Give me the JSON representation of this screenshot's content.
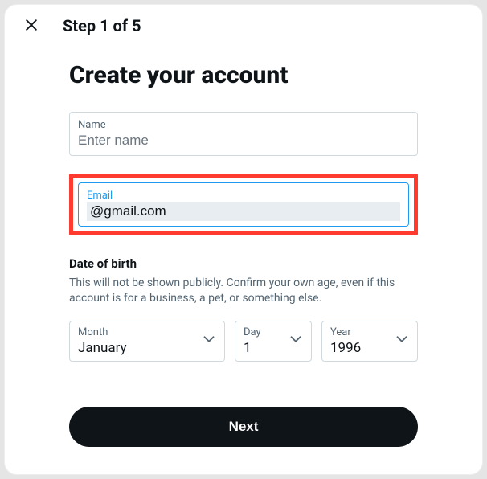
{
  "header": {
    "step_text": "Step 1 of 5"
  },
  "title": "Create your account",
  "name_field": {
    "label": "Name",
    "placeholder": "Enter name",
    "value": ""
  },
  "email_field": {
    "label": "Email",
    "value": "@gmail.com"
  },
  "dob": {
    "title": "Date of birth",
    "description": "This will not be shown publicly. Confirm your own age, even if this account is for a business, a pet, or something else.",
    "month": {
      "label": "Month",
      "value": "January"
    },
    "day": {
      "label": "Day",
      "value": "1"
    },
    "year": {
      "label": "Year",
      "value": "1996"
    }
  },
  "next_label": "Next",
  "colors": {
    "accent": "#1d9bf0",
    "highlight": "#ff3b30",
    "primary_text": "#0f1419",
    "secondary_text": "#536471"
  }
}
